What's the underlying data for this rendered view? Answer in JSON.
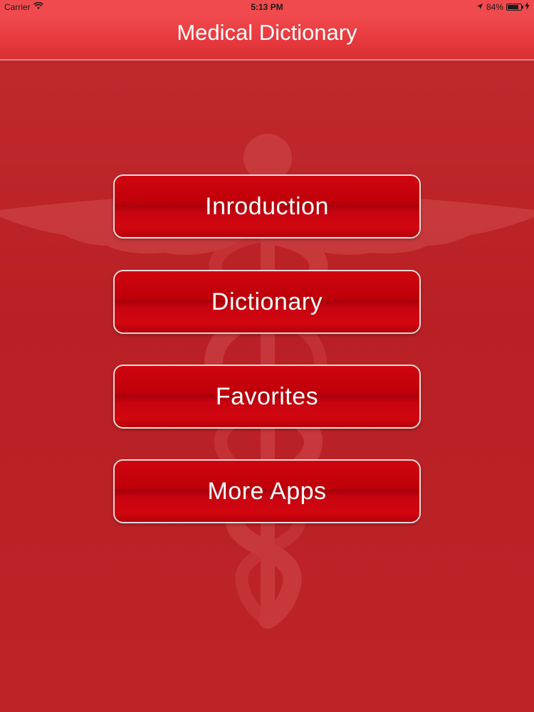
{
  "status_bar": {
    "carrier": "Carrier",
    "time": "5:13 PM",
    "battery": "84%",
    "battery_level": 0.84
  },
  "nav": {
    "title": "Medical Dictionary"
  },
  "menu": {
    "items": [
      {
        "label": "Inroduction"
      },
      {
        "label": "Dictionary"
      },
      {
        "label": "Favorites"
      },
      {
        "label": "More Apps"
      }
    ]
  },
  "icons": {
    "wifi": "wifi-icon",
    "location": "location-arrow-icon",
    "battery": "battery-icon",
    "charging": "charging-bolt-icon",
    "emblem": "caduceus-icon"
  },
  "colors": {
    "background": "#bb2226",
    "nav_bar": "#e6393d",
    "button": "#c80410",
    "button_border": "#f5d9da"
  }
}
